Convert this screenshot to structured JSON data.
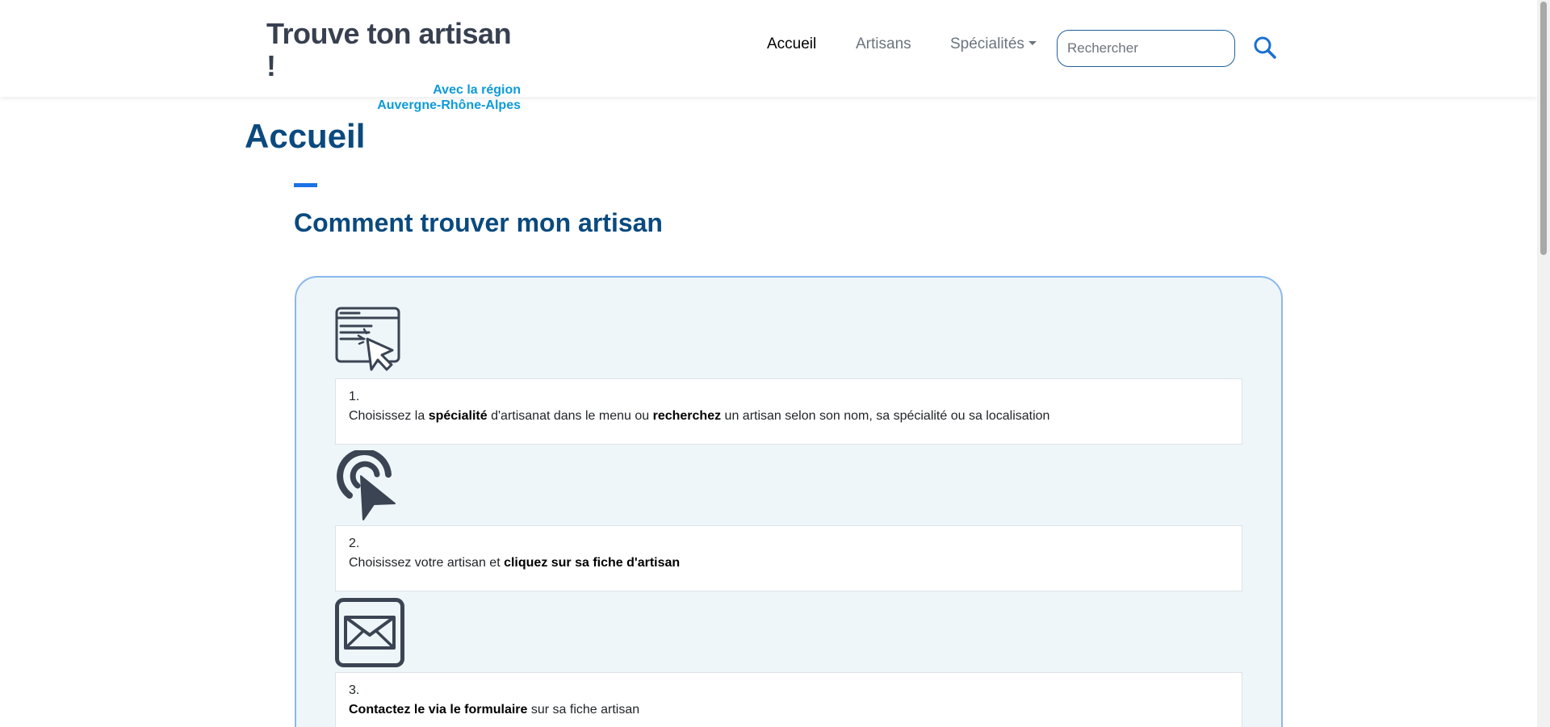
{
  "brand": {
    "title": "Trouve ton artisan !",
    "subtitle_line1": "Avec la région",
    "subtitle_line2": "Auvergne-Rhône-Alpes"
  },
  "nav": {
    "items": [
      {
        "label": "Accueil",
        "active": true
      },
      {
        "label": "Artisans",
        "active": false
      },
      {
        "label": "Spécialités",
        "active": false,
        "dropdown": true
      }
    ],
    "search_placeholder": "Rechercher",
    "search_icon": "search-icon"
  },
  "main": {
    "page_title": "Accueil",
    "section_title": "Comment trouver mon artisan"
  },
  "steps": [
    {
      "number": "1.",
      "icon": "browser-click-icon",
      "parts": [
        "Choisissez la ",
        "spécialité",
        " d'artisanat dans le menu ou ",
        "recherchez",
        " un artisan selon son nom, sa spécialité ou sa localisation"
      ]
    },
    {
      "number": "2.",
      "icon": "tap-pointer-icon",
      "parts": [
        "Choisissez votre artisan et ",
        "cliquez sur sa fiche d'artisan"
      ]
    },
    {
      "number": "3.",
      "icon": "envelope-icon",
      "parts": [
        "Contactez le via le formulaire",
        " sur sa fiche artisan"
      ]
    }
  ],
  "colors": {
    "brand_dark": "#384050",
    "brand_accent": "#0d9bd9",
    "heading": "#0a4a7e",
    "accent_bar": "#1a73e8",
    "card_background": "#eef6f9",
    "card_border": "#8bb8ee"
  }
}
